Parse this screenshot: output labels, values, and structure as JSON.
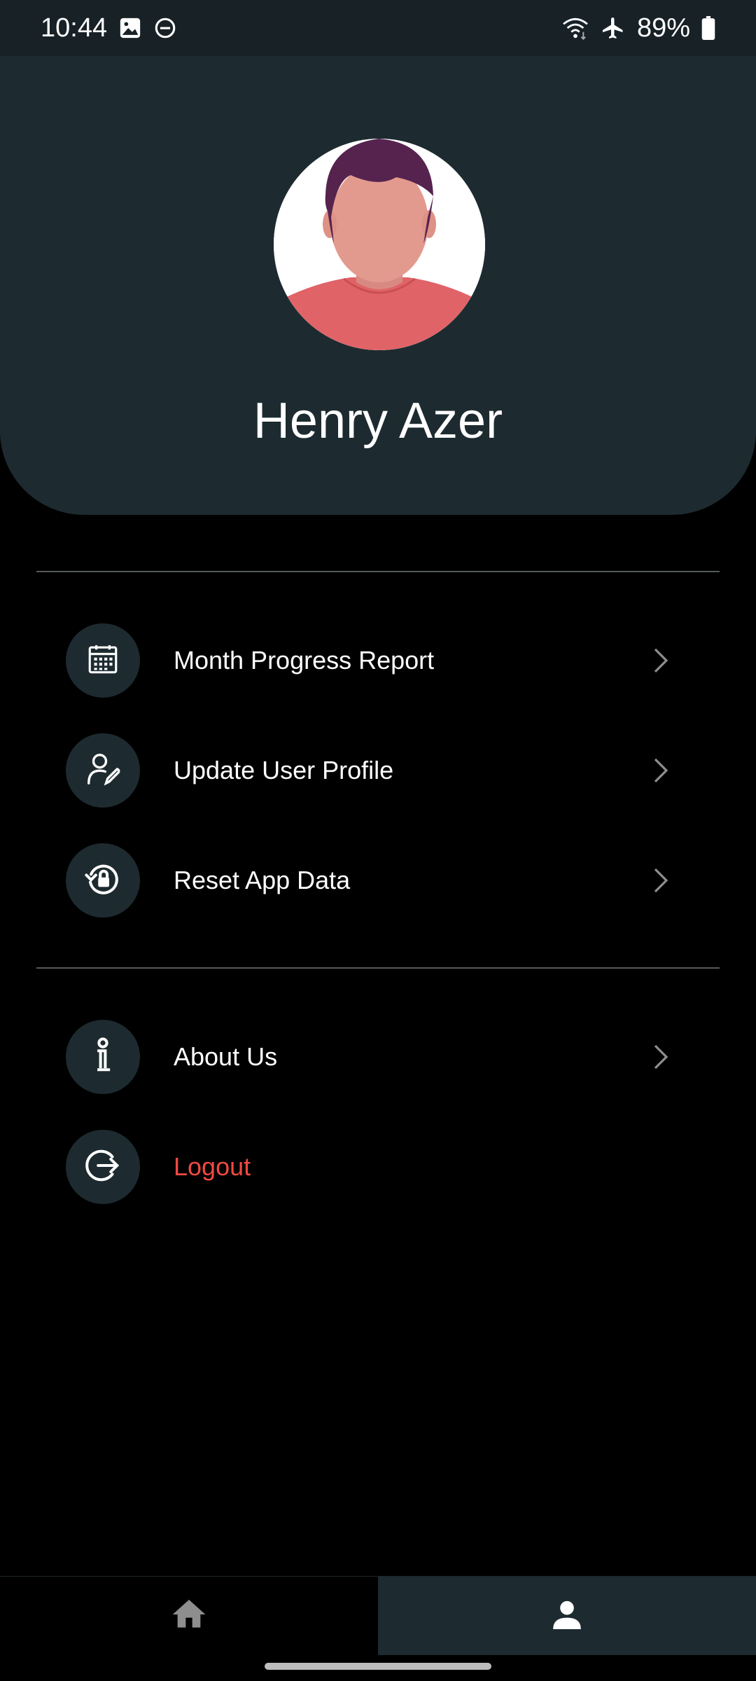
{
  "status_bar": {
    "time": "10:44",
    "battery": "89%",
    "icons": [
      "image-icon",
      "dnd-icon",
      "wifi-icon",
      "airplane-icon",
      "battery-icon"
    ]
  },
  "profile": {
    "name": "Henry Azer"
  },
  "menu": {
    "group1": [
      {
        "label": "Month Progress Report",
        "icon": "calendar-icon"
      },
      {
        "label": "Update User Profile",
        "icon": "user-edit-icon"
      },
      {
        "label": "Reset App Data",
        "icon": "reset-lock-icon"
      }
    ],
    "group2": [
      {
        "label": "About Us",
        "icon": "info-icon"
      },
      {
        "label": "Logout",
        "icon": "logout-icon"
      }
    ]
  },
  "bottom_nav": {
    "tabs": [
      {
        "name": "home",
        "icon": "home-icon",
        "active": false
      },
      {
        "name": "profile",
        "icon": "person-icon",
        "active": true
      }
    ]
  },
  "colors": {
    "header_bg": "#1d2b30",
    "status_bg": "#172126",
    "danger": "#ef4a42",
    "chevron": "#8e8e8e"
  }
}
